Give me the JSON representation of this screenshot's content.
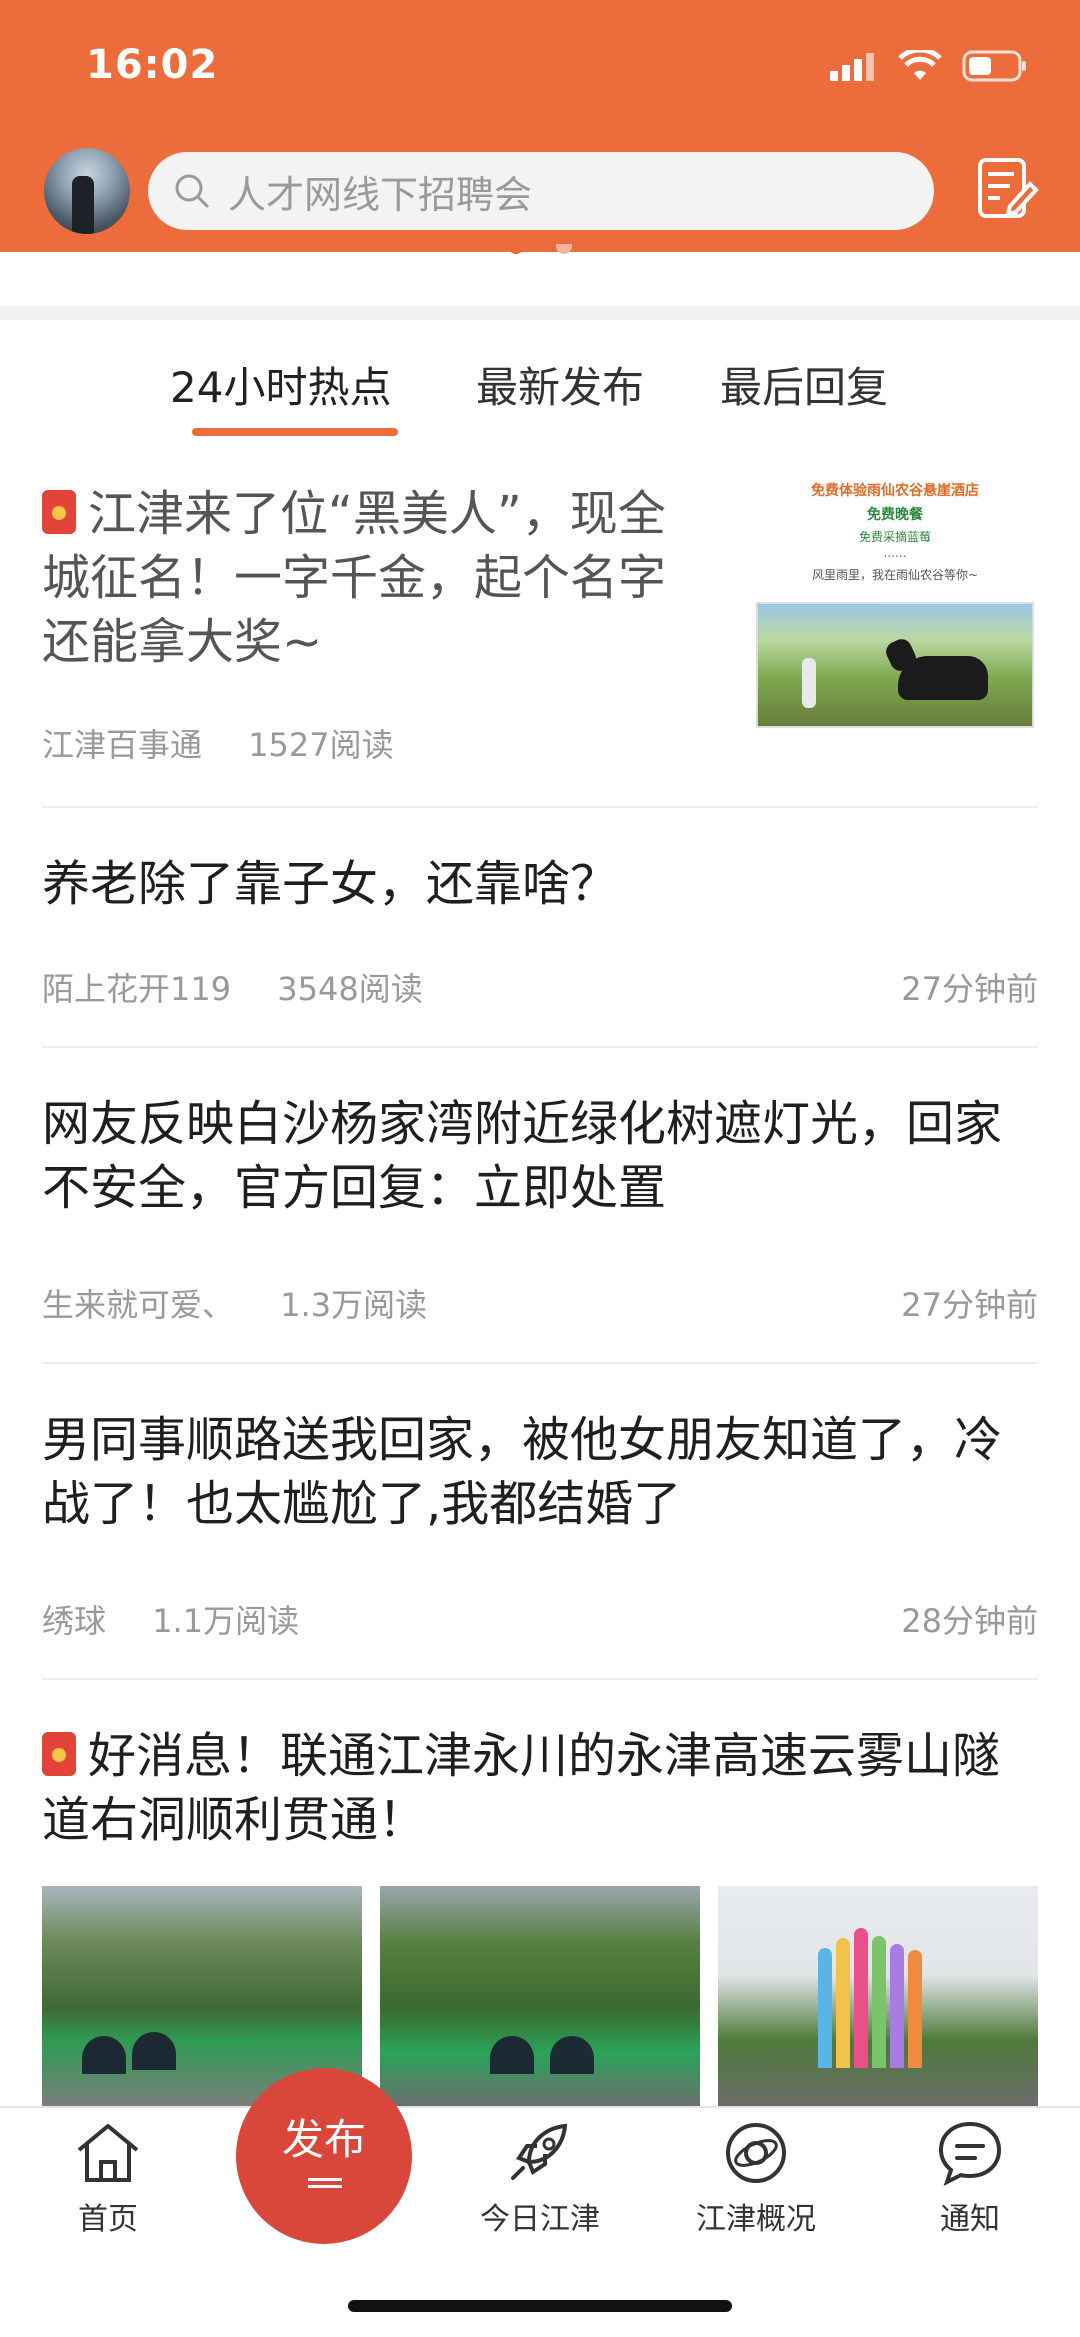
{
  "status_bar": {
    "time": "16:02"
  },
  "header": {
    "search_placeholder": "人才网线下招聘会"
  },
  "tabs": [
    {
      "label": "24小时热点",
      "active": true
    },
    {
      "label": "最新发布",
      "active": false
    },
    {
      "label": "最后回复",
      "active": false
    }
  ],
  "articles": [
    {
      "title": "江津来了位“黑美人”，现全城征名！一字千金，起个名字还能拿大奖~",
      "source": "江津百事通",
      "reads": "1527阅读",
      "time": "",
      "red_packet": true,
      "thumb": {
        "line1": "免费体验雨仙农谷悬崖酒店",
        "line2": "免费晚餐",
        "line3": "免费采摘蓝莓",
        "line4": "......",
        "line5": "风里雨里，我在雨仙农谷等你~"
      }
    },
    {
      "title": "养老除了靠子女，还靠啥？",
      "source": "陌上花开119",
      "reads": "3548阅读",
      "time": "27分钟前"
    },
    {
      "title": "网友反映白沙杨家湾附近绿化树遮灯光，回家不安全，官方回复：立即处置",
      "source": "生来就可爱、",
      "reads": "1.3万阅读",
      "time": "27分钟前"
    },
    {
      "title": "男同事顺路送我回家，被他女朋友知道了，冷战了！也太尴尬了,我都结婚了",
      "source": "绣球",
      "reads": "1.1万阅读",
      "time": "28分钟前"
    },
    {
      "title": "好消息！联通江津永川的永津高速云雾山隧道右洞顺利贯通！",
      "red_packet": true
    }
  ],
  "bottom_nav": {
    "items": [
      {
        "label": "首页",
        "icon": "home-icon"
      },
      {
        "label": "发布",
        "icon": "publish-icon"
      },
      {
        "label": "今日江津",
        "icon": "rocket-icon"
      },
      {
        "label": "江津概况",
        "icon": "planet-icon"
      },
      {
        "label": "通知",
        "icon": "chat-bubble-icon"
      }
    ]
  },
  "colors": {
    "brand": "#EC6C3C",
    "publish": "#D9473B",
    "red_packet": "#E2443A"
  }
}
